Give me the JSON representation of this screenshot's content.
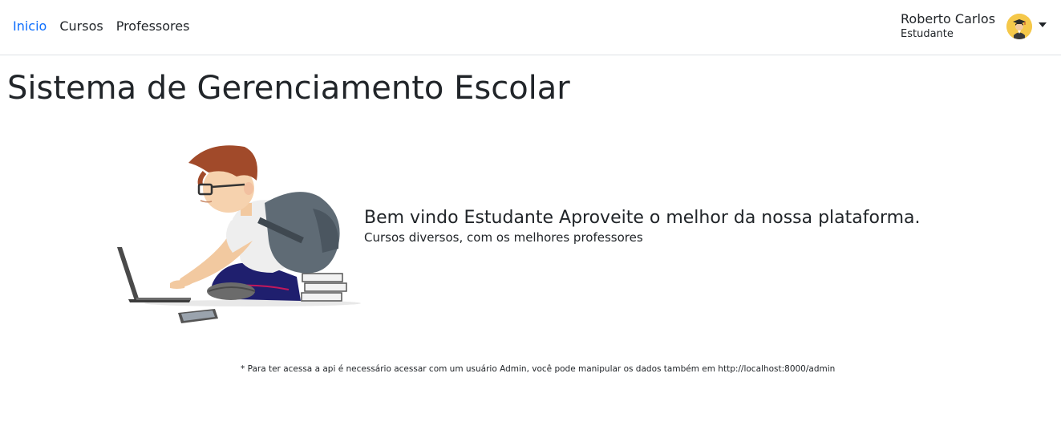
{
  "nav": {
    "links": [
      {
        "label": "Inicio",
        "active": true
      },
      {
        "label": "Cursos",
        "active": false
      },
      {
        "label": "Professores",
        "active": false
      }
    ]
  },
  "user": {
    "name": "Roberto Carlos",
    "role": "Estudante",
    "avatar_icon": "student-graduate-avatar-icon",
    "avatar_color": "#f5c84a"
  },
  "page": {
    "title": "Sistema de Gerenciamento Escolar"
  },
  "hero": {
    "illustration": "student-with-laptop-illustration",
    "heading": "Bem vindo Estudante Aproveite o melhor da nossa plataforma.",
    "subheading": "Cursos diversos, com os melhores professores"
  },
  "footer": {
    "note": "* Para ter acessa a api é necessário acessar com um usuário Admin, você pode manipular os dados também em http://localhost:8000/admin"
  },
  "colors": {
    "active_link": "#0d6efd",
    "text": "#212529",
    "border": "#dee2e6"
  }
}
